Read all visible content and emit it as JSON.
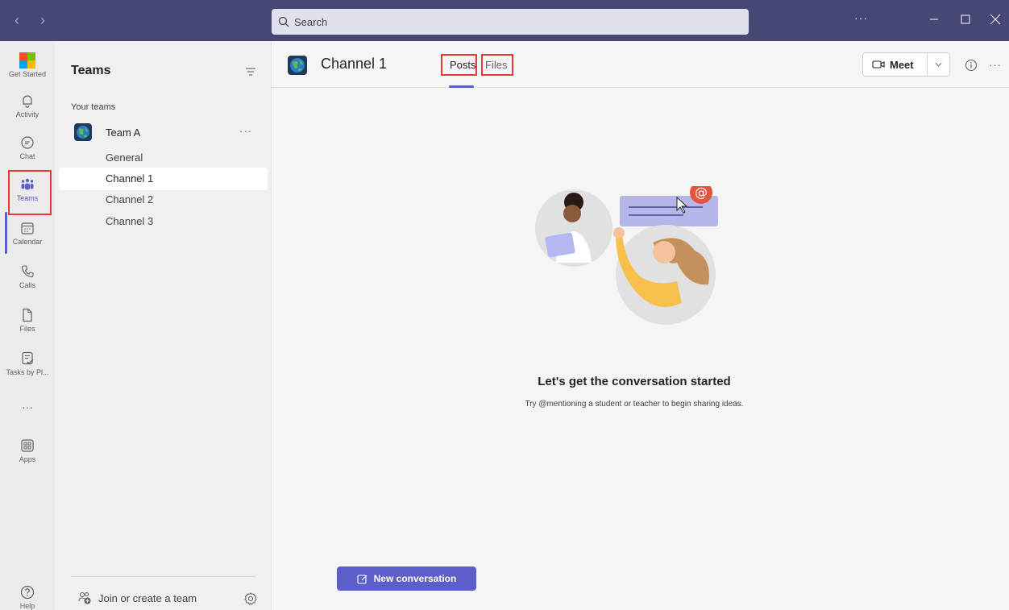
{
  "titlebar": {
    "back_label": "‹",
    "forward_label": "›",
    "search_placeholder": "Search",
    "more_label": "···",
    "color": "#464775"
  },
  "rail": {
    "items": [
      {
        "label": "Get Started",
        "icon": "get-started-icon"
      },
      {
        "label": "Activity",
        "icon": "bell-icon"
      },
      {
        "label": "Chat",
        "icon": "chat-icon"
      },
      {
        "label": "Teams",
        "icon": "teams-icon",
        "active": true
      },
      {
        "label": "Calendar",
        "icon": "calendar-icon"
      },
      {
        "label": "Calls",
        "icon": "phone-icon"
      },
      {
        "label": "Files",
        "icon": "file-icon"
      },
      {
        "label": "Tasks by Pl...",
        "icon": "tasks-icon"
      },
      {
        "label": "···",
        "icon": "more-icon"
      },
      {
        "label": "Apps",
        "icon": "apps-icon"
      },
      {
        "label": "Help",
        "icon": "help-icon"
      }
    ]
  },
  "panel": {
    "title": "Teams",
    "section_label": "Your teams",
    "team": {
      "name": "Team A",
      "more_label": "···"
    },
    "channels": [
      {
        "name": "General",
        "active": false
      },
      {
        "name": "Channel 1",
        "active": true
      },
      {
        "name": "Channel 2",
        "active": false
      },
      {
        "name": "Channel 3",
        "active": false
      }
    ],
    "join_label": "Join or create a team"
  },
  "main": {
    "channel_title": "Channel 1",
    "tabs": [
      {
        "label": "Posts",
        "active": true
      },
      {
        "label": "Files",
        "active": false
      }
    ],
    "meet_label": "Meet",
    "more_label": "···",
    "empty_title": "Let's get the conversation started",
    "empty_subtitle": "Try @mentioning a student or teacher to begin sharing ideas.",
    "new_conversation_label": "New conversation",
    "accent_color": "#5b5fc7"
  }
}
